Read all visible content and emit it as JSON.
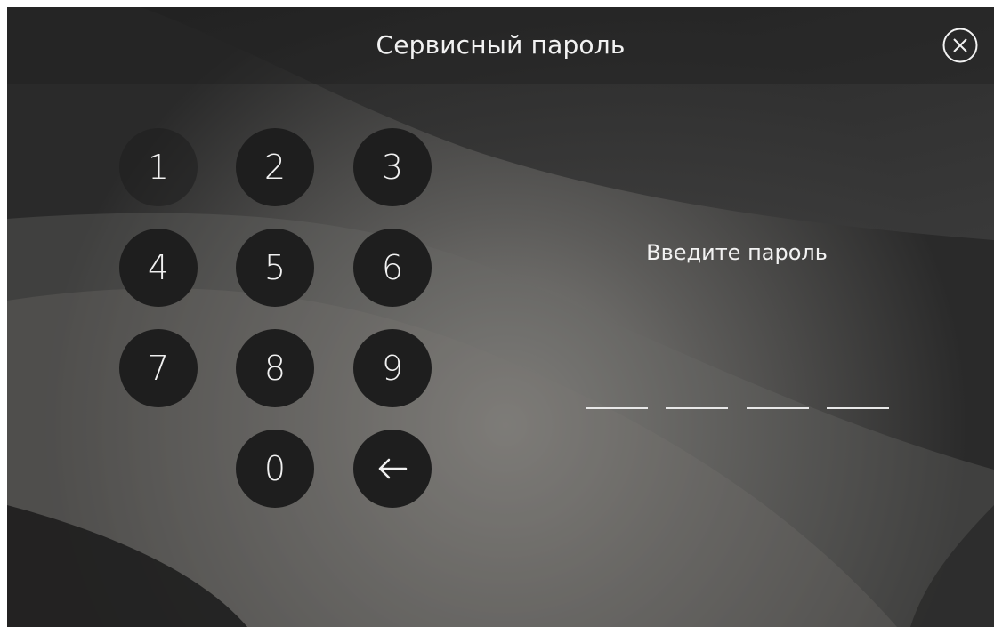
{
  "header": {
    "title": "Сервисный пароль",
    "close_icon": "close-circle-icon"
  },
  "keypad": {
    "keys": [
      {
        "label": "1"
      },
      {
        "label": "2"
      },
      {
        "label": "3"
      },
      {
        "label": "4"
      },
      {
        "label": "5"
      },
      {
        "label": "6"
      },
      {
        "label": "7"
      },
      {
        "label": "8"
      },
      {
        "label": "9"
      },
      {
        "label": "0"
      },
      {
        "icon": "backspace-arrow-icon"
      }
    ]
  },
  "password": {
    "prompt": "Введите пароль",
    "length": 4,
    "entered": 0
  },
  "colors": {
    "background": "#2b2b2b",
    "key_fill": "#1e1e1e",
    "text": "#f2f2f2"
  }
}
